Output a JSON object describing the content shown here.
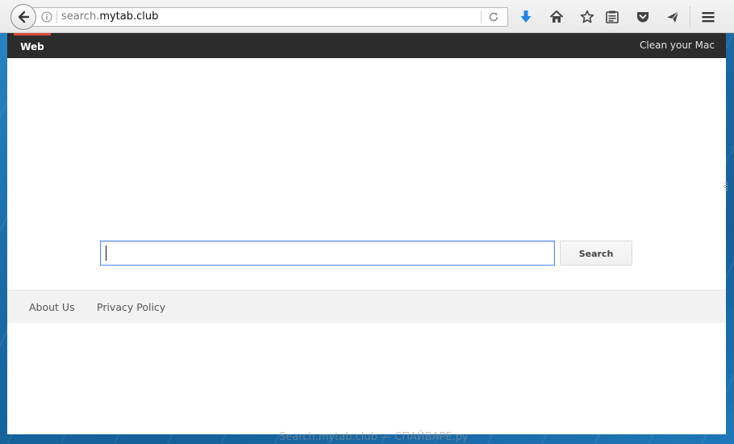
{
  "browser": {
    "url_prefix": "search.",
    "url_domain": "mytab.club"
  },
  "nav": {
    "web_tab": "Web",
    "right_link": "Clean your Mac"
  },
  "search": {
    "input_value": "",
    "button_label": "Search"
  },
  "footer": {
    "links": [
      "About Us",
      "Privacy Policy"
    ]
  },
  "watermark": "Search.mytab.club — СПАЙВАРЕ.ру",
  "colors": {
    "nav_bg": "#2c2c2c",
    "nav_active_accent": "#dd4b39",
    "download_arrow": "#1e88e5",
    "input_focus_border": "#4d90fe",
    "footer_bg": "#f2f2f2"
  },
  "icons": {
    "back": "back-arrow-icon",
    "info": "info-icon",
    "reload": "reload-icon",
    "download": "download-icon",
    "home": "home-icon",
    "bookmark": "star-icon",
    "reader": "reading-list-icon",
    "pocket": "pocket-icon",
    "share": "send-icon",
    "menu": "hamburger-menu-icon"
  }
}
